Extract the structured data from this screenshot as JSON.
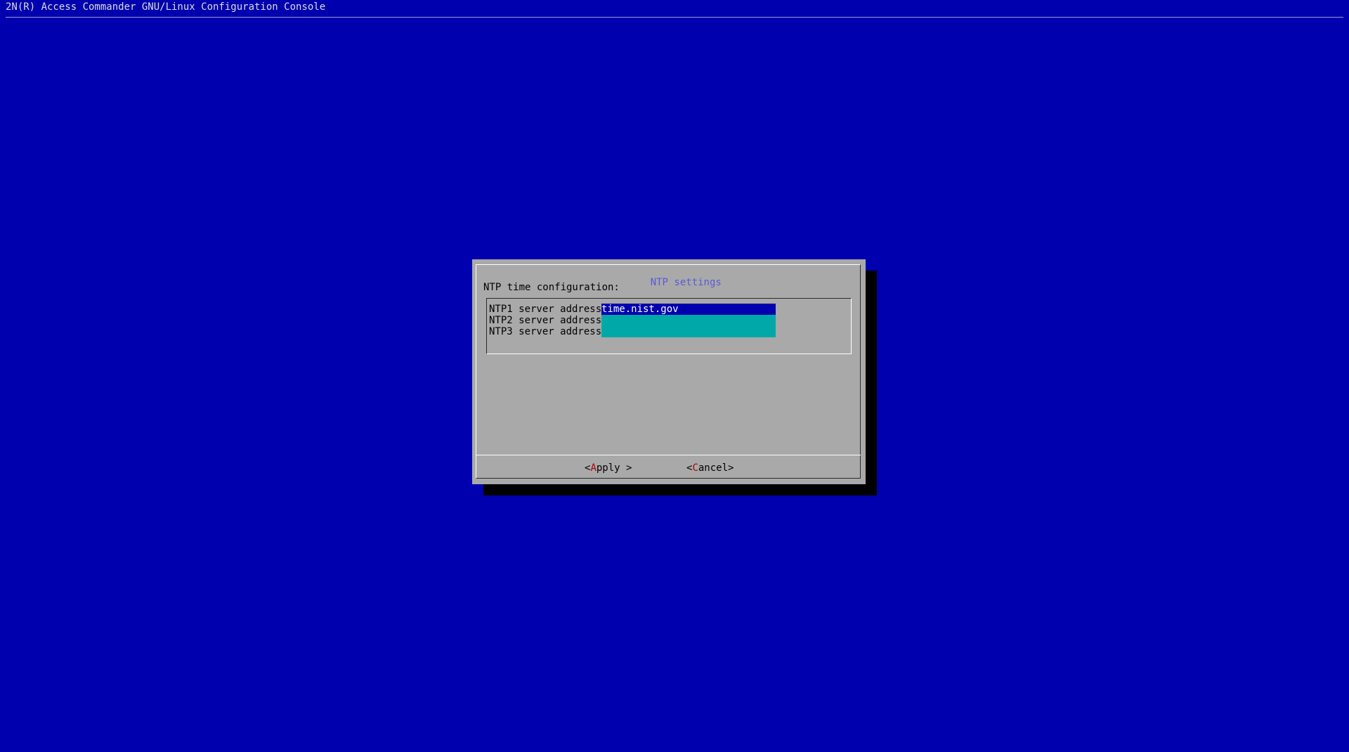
{
  "backtitle": "2N(R) Access Commander GNU/Linux Configuration Console",
  "dialog": {
    "title": "NTP settings",
    "prompt": "NTP time configuration:",
    "fields": [
      {
        "label": "NTP1 server address",
        "value": "time.nist.gov"
      },
      {
        "label": "NTP2 server address",
        "value": ""
      },
      {
        "label": "NTP3 server address",
        "value": ""
      }
    ],
    "buttons": {
      "apply": {
        "open": "<",
        "hotkey": "A",
        "rest": "pply",
        "close": " >"
      },
      "cancel": {
        "open": "<",
        "hotkey": "C",
        "rest": "ancel",
        "close": ">"
      }
    }
  },
  "colors": {
    "screen_bg": "#0000ae",
    "dialog_bg": "#a9a9a9",
    "field_bg": "#00a8a8",
    "active_field_bg": "#0000ae",
    "hotkey": "#b00000",
    "title": "#5a5ad8"
  }
}
